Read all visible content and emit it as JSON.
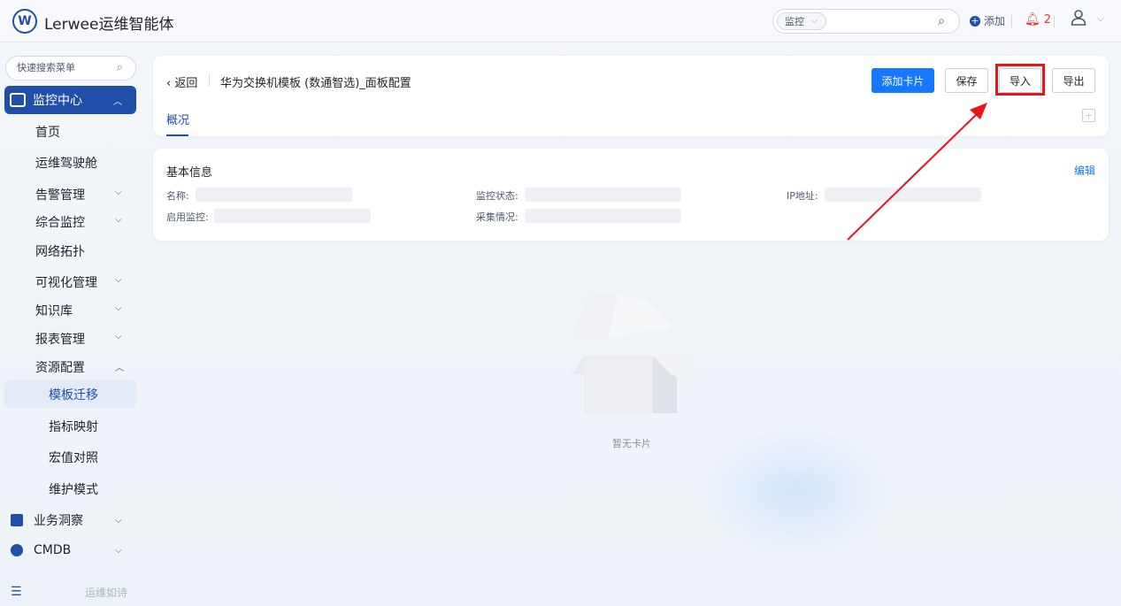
{
  "app": {
    "brand": "Lerwee运维智能体",
    "logo_glyph": "W"
  },
  "topbar": {
    "search_scope": "监控",
    "add_label": "添加",
    "alert_count": "2"
  },
  "sidebar": {
    "search_placeholder": "快速搜索菜单",
    "group_monitor": "监控中心",
    "items": {
      "home": "首页",
      "cockpit": "运维驾驶舱",
      "alert": "告警管理",
      "integrated": "综合监控",
      "topology": "网络拓扑",
      "visual": "可视化管理",
      "knowledge": "知识库",
      "report": "报表管理",
      "resource": "资源配置"
    },
    "sub_items": {
      "template_migration": "模板迁移",
      "metric_mapping": "指标映射",
      "macro": "宏值对照",
      "maintenance": "维护模式"
    },
    "group_business": "业务洞察",
    "group_cmdb": "CMDB",
    "footer_text": "运维如诗"
  },
  "page": {
    "back_label": "返回",
    "title": "华为交换机模板 (数通智选)_面板配置",
    "buttons": {
      "add_card": "添加卡片",
      "save": "保存",
      "import": "导入",
      "export": "导出"
    },
    "tab_overview": "概况",
    "tab_add": "+"
  },
  "basic_info": {
    "title": "基本信息",
    "edit": "编辑",
    "labels": {
      "name": "名称:",
      "monitor_status": "监控状态:",
      "ip": "IP地址:",
      "enabled": "启用监控:",
      "collect": "采集情况:"
    }
  },
  "empty_state": {
    "text": "暂无卡片"
  },
  "colors": {
    "brand": "#1f4fa8",
    "primary": "#1677ff",
    "annotation": "#e8161a",
    "alert": "#e53935"
  }
}
